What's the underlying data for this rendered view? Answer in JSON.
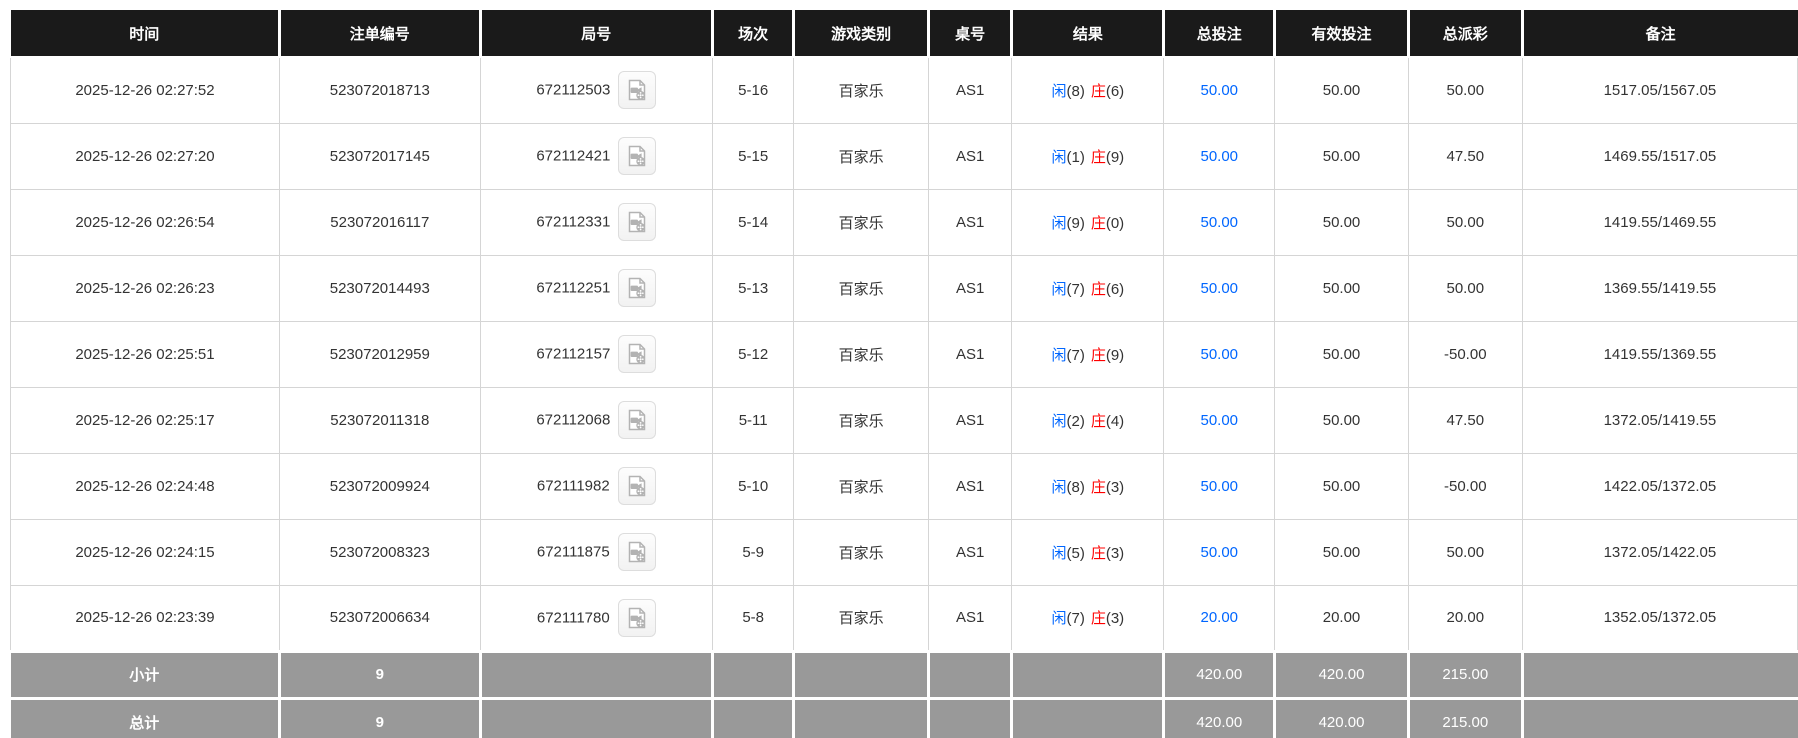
{
  "colors": {
    "header_bg": "#1a1a1a",
    "accent_blue": "#0066ff",
    "negative_red": "#ff0000",
    "total_row_bg": "#999999",
    "cell_border": "#d5d5d5"
  },
  "table": {
    "columns": [
      {
        "key": "time",
        "label": "时间"
      },
      {
        "key": "bet_id",
        "label": "注单编号"
      },
      {
        "key": "round_id",
        "label": "局号"
      },
      {
        "key": "session",
        "label": "场次"
      },
      {
        "key": "game_type",
        "label": "游戏类别"
      },
      {
        "key": "table_no",
        "label": "桌号"
      },
      {
        "key": "result",
        "label": "结果"
      },
      {
        "key": "total_bet",
        "label": "总投注"
      },
      {
        "key": "valid_bet",
        "label": "有效投注"
      },
      {
        "key": "total_payout",
        "label": "总派彩"
      },
      {
        "key": "remark",
        "label": "备注"
      }
    ],
    "icons": {
      "video_replay": "video-file-icon"
    },
    "rows": [
      {
        "time": "2025-12-26 02:27:52",
        "bet_id": "523072018713",
        "round_id": "672112503",
        "session": "5-16",
        "game_type": "百家乐",
        "table_no": "AS1",
        "result": {
          "p_label": "闲",
          "p_score": "(8)",
          "b_label": "庄",
          "b_score": "(6)"
        },
        "total_bet": "50.00",
        "valid_bet": "50.00",
        "total_payout": "50.00",
        "payout_negative": false,
        "remark": "1517.05/1567.05"
      },
      {
        "time": "2025-12-26 02:27:20",
        "bet_id": "523072017145",
        "round_id": "672112421",
        "session": "5-15",
        "game_type": "百家乐",
        "table_no": "AS1",
        "result": {
          "p_label": "闲",
          "p_score": "(1)",
          "b_label": "庄",
          "b_score": "(9)"
        },
        "total_bet": "50.00",
        "valid_bet": "50.00",
        "total_payout": "47.50",
        "payout_negative": false,
        "remark": "1469.55/1517.05"
      },
      {
        "time": "2025-12-26 02:26:54",
        "bet_id": "523072016117",
        "round_id": "672112331",
        "session": "5-14",
        "game_type": "百家乐",
        "table_no": "AS1",
        "result": {
          "p_label": "闲",
          "p_score": "(9)",
          "b_label": "庄",
          "b_score": "(0)"
        },
        "total_bet": "50.00",
        "valid_bet": "50.00",
        "total_payout": "50.00",
        "payout_negative": false,
        "remark": "1419.55/1469.55"
      },
      {
        "time": "2025-12-26 02:26:23",
        "bet_id": "523072014493",
        "round_id": "672112251",
        "session": "5-13",
        "game_type": "百家乐",
        "table_no": "AS1",
        "result": {
          "p_label": "闲",
          "p_score": "(7)",
          "b_label": "庄",
          "b_score": "(6)"
        },
        "total_bet": "50.00",
        "valid_bet": "50.00",
        "total_payout": "50.00",
        "payout_negative": false,
        "remark": "1369.55/1419.55"
      },
      {
        "time": "2025-12-26 02:25:51",
        "bet_id": "523072012959",
        "round_id": "672112157",
        "session": "5-12",
        "game_type": "百家乐",
        "table_no": "AS1",
        "result": {
          "p_label": "闲",
          "p_score": "(7)",
          "b_label": "庄",
          "b_score": "(9)"
        },
        "total_bet": "50.00",
        "valid_bet": "50.00",
        "total_payout": "-50.00",
        "payout_negative": true,
        "remark": "1419.55/1369.55"
      },
      {
        "time": "2025-12-26 02:25:17",
        "bet_id": "523072011318",
        "round_id": "672112068",
        "session": "5-11",
        "game_type": "百家乐",
        "table_no": "AS1",
        "result": {
          "p_label": "闲",
          "p_score": "(2)",
          "b_label": "庄",
          "b_score": "(4)"
        },
        "total_bet": "50.00",
        "valid_bet": "50.00",
        "total_payout": "47.50",
        "payout_negative": false,
        "remark": "1372.05/1419.55"
      },
      {
        "time": "2025-12-26 02:24:48",
        "bet_id": "523072009924",
        "round_id": "672111982",
        "session": "5-10",
        "game_type": "百家乐",
        "table_no": "AS1",
        "result": {
          "p_label": "闲",
          "p_score": "(8)",
          "b_label": "庄",
          "b_score": "(3)"
        },
        "total_bet": "50.00",
        "valid_bet": "50.00",
        "total_payout": "-50.00",
        "payout_negative": true,
        "remark": "1422.05/1372.05"
      },
      {
        "time": "2025-12-26 02:24:15",
        "bet_id": "523072008323",
        "round_id": "672111875",
        "session": "5-9",
        "game_type": "百家乐",
        "table_no": "AS1",
        "result": {
          "p_label": "闲",
          "p_score": "(5)",
          "b_label": "庄",
          "b_score": "(3)"
        },
        "total_bet": "50.00",
        "valid_bet": "50.00",
        "total_payout": "50.00",
        "payout_negative": false,
        "remark": "1372.05/1422.05"
      },
      {
        "time": "2025-12-26 02:23:39",
        "bet_id": "523072006634",
        "round_id": "672111780",
        "session": "5-8",
        "game_type": "百家乐",
        "table_no": "AS1",
        "result": {
          "p_label": "闲",
          "p_score": "(7)",
          "b_label": "庄",
          "b_score": "(3)"
        },
        "total_bet": "20.00",
        "valid_bet": "20.00",
        "total_payout": "20.00",
        "payout_negative": false,
        "remark": "1352.05/1372.05"
      }
    ],
    "subtotal": {
      "label": "小计",
      "count": "9",
      "total_bet": "420.00",
      "valid_bet": "420.00",
      "total_payout": "215.00"
    },
    "grand_total": {
      "label": "总计",
      "count": "9",
      "total_bet": "420.00",
      "valid_bet": "420.00",
      "total_payout": "215.00"
    }
  }
}
